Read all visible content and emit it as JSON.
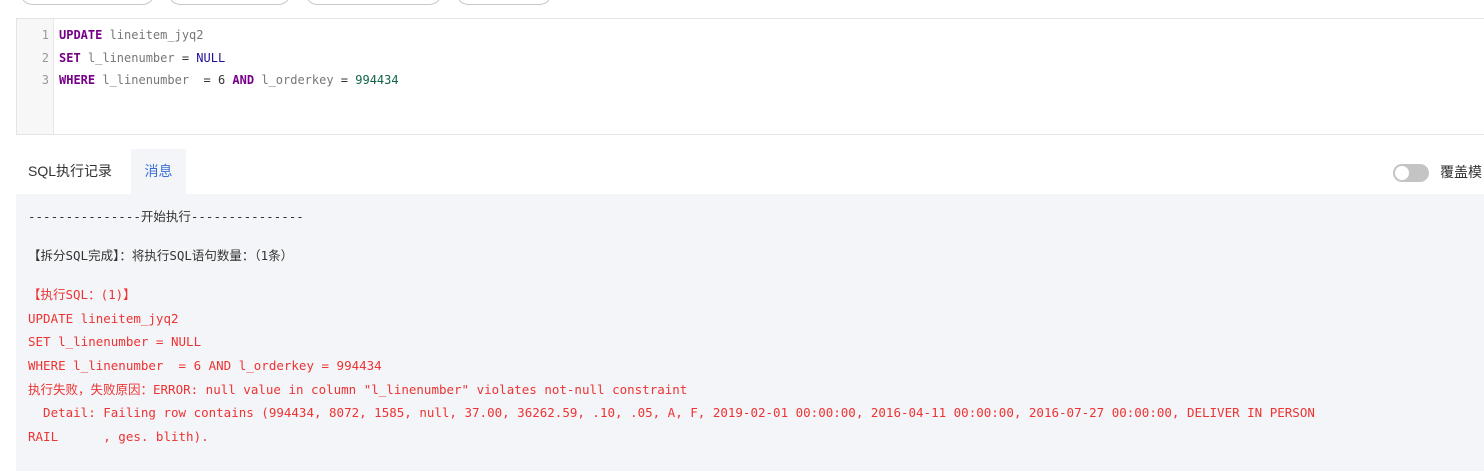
{
  "editor": {
    "line_numbers": [
      "1",
      "2",
      "3"
    ],
    "lines": [
      [
        {
          "cls": "kw",
          "text": "UPDATE"
        },
        {
          "cls": "id",
          "text": " lineitem_jyq2"
        }
      ],
      [
        {
          "cls": "kw",
          "text": "SET"
        },
        {
          "cls": "id",
          "text": " l_linenumber "
        },
        {
          "cls": "op",
          "text": "="
        },
        {
          "cls": "nul",
          "text": " NULL"
        }
      ],
      [
        {
          "cls": "kw",
          "text": "WHERE"
        },
        {
          "cls": "id",
          "text": " l_linenumber  "
        },
        {
          "cls": "op",
          "text": "= 6 "
        },
        {
          "cls": "kw",
          "text": "AND"
        },
        {
          "cls": "id",
          "text": " l_orderkey "
        },
        {
          "cls": "op",
          "text": "= "
        },
        {
          "cls": "num",
          "text": "994434"
        }
      ]
    ]
  },
  "tabs": {
    "sql_log": "SQL执行记录",
    "messages": "消息"
  },
  "toggle": {
    "label": "覆盖模",
    "on": false
  },
  "messages": {
    "start": "---------------开始执行---------------",
    "split": "【拆分SQL完成】：将执行SQL语句数量：（1条）",
    "exec_header": "【执行SQL：(1)】",
    "sql_line_1": "UPDATE lineitem_jyq2",
    "sql_line_2": "SET l_linenumber = NULL",
    "sql_line_3": "WHERE l_linenumber  = 6 AND l_orderkey = 994434",
    "error": "执行失败，失败原因：ERROR: null value in column \"l_linenumber\" violates not-null constraint",
    "detail": "  Detail: Failing row contains (994434, 8072, 1585, null, 37.00, 36262.59, .10, .05, A, F, 2019-02-01 00:00:00, 2016-04-11 00:00:00, 2016-07-27 00:00:00, DELIVER IN PERSON",
    "detail_cont": "RAIL      , ges. blith)."
  },
  "colors": {
    "keyword": "#770088",
    "null_literal": "#221199",
    "number": "#116644",
    "error_text": "#ee3333",
    "active_tab": "#3b6fd6",
    "panel_bg": "#f3f5f8"
  }
}
